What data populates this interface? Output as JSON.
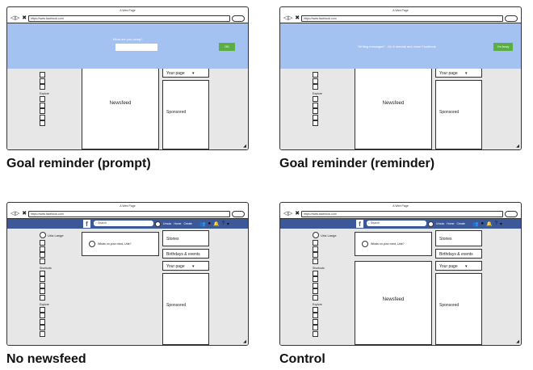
{
  "browser": {
    "window_title": "A Web Page",
    "url": "https://www.facebook.com",
    "nav_icons": "◁▷ ✖ ⌂",
    "menu_icon": "hamburger-pill",
    "resize_icon": "◢"
  },
  "fb": {
    "logo": "f",
    "search_placeholder": "Search",
    "nav_user": "Ursula",
    "nav_home": "Home",
    "nav_create": "Create",
    "icons": [
      "friends-icon",
      "messenger-icon",
      "bell-icon",
      "help-icon",
      "caret-icon"
    ],
    "user_name": "Urla Lange",
    "post_prompt": "Whats on your mind, Urla?",
    "shortcuts_label": "Shortcuts",
    "explore_label": "Explore",
    "stories": "Stories",
    "birthdays": "Birthdays & events",
    "your_page": "Your page",
    "your_page_caret": "▾",
    "newsfeed": "Newsfeed",
    "sponsored": "Sponsored"
  },
  "panels": {
    "prompt": {
      "caption": "Goal reminder (prompt)",
      "overlay_text": "What are you doing?",
      "button": "OK"
    },
    "reminder": {
      "caption": "Goal reminder (reminder)",
      "overlay_text": "\"Writing messages\" - Do it already and close Facebook",
      "button": "I'm busy"
    },
    "no_newsfeed": {
      "caption": "No newsfeed"
    },
    "control": {
      "caption": "Control"
    }
  },
  "colors": {
    "fb_blue": "#3b5998",
    "overlay_blue": "#a3c1f1",
    "ok_green": "#5aae42",
    "page_grey": "#e7e7e7"
  }
}
